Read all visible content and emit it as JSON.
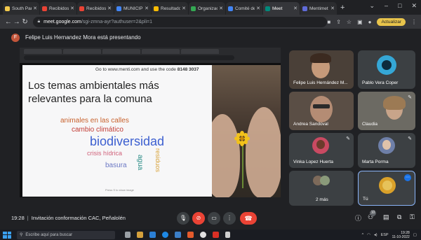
{
  "browser": {
    "tabs": [
      {
        "label": "South Par",
        "color": "#f2c94c",
        "active": false
      },
      {
        "label": "Recibidos",
        "color": "#ea4335",
        "active": false
      },
      {
        "label": "Recibidos",
        "color": "#ea4335",
        "active": false
      },
      {
        "label": "MUNICIP",
        "color": "#4285f4",
        "active": false
      },
      {
        "label": "Resultado",
        "color": "#fbbc04",
        "active": false
      },
      {
        "label": "Organizac",
        "color": "#34a853",
        "active": false
      },
      {
        "label": "Comité de",
        "color": "#4285f4",
        "active": false
      },
      {
        "label": "Meet",
        "color": "#00897b",
        "active": true
      },
      {
        "label": "Mentimet",
        "color": "#5f6bd8",
        "active": false
      }
    ],
    "new_tab": "+",
    "url_domain": "meet.google.com",
    "url_path": "/sgi-zmna-ayr?authuser=2&pli=1",
    "update_button": "Actualizar"
  },
  "banner": {
    "initial": "F",
    "text": "Felipe Luis Hernandez Mora está presentando"
  },
  "slide": {
    "code_prefix": "Go to www.menti.com and use the code",
    "code": "8148 3037",
    "title": "Los temas ambientales más relevantes para la comuna",
    "words": {
      "animales": "animales en las calles",
      "cambio": "cambio climático",
      "bio": "biodiversidad",
      "crisis": "crisis hídrica",
      "basura": "basura",
      "agua": "agua",
      "residuos": "residuos"
    },
    "footer": "Press S to show image"
  },
  "participants": [
    {
      "name": "Felipe Luis Hernández M...",
      "type": "video"
    },
    {
      "name": "Pablo Vera Coper",
      "type": "avatar",
      "color": "#35a7d6"
    },
    {
      "name": "Andrea Sandoval",
      "type": "video"
    },
    {
      "name": "Claudia",
      "type": "video"
    },
    {
      "name": "Vinka Lopez Huerta",
      "type": "avatar",
      "color": "#c94a62"
    },
    {
      "name": "Marta Porma",
      "type": "avatar",
      "color": "#6e7fa8"
    },
    {
      "name": "2 más",
      "type": "more"
    },
    {
      "name": "Tú",
      "type": "self"
    }
  ],
  "meetbar": {
    "time": "19:28",
    "meeting_title": "Invitación conformación CAC, Peñalolén",
    "participant_count": "10"
  },
  "taskbar": {
    "search_placeholder": "Escribe aquí para buscar",
    "lang": "ESP",
    "time": "19:28",
    "date": "11-10-2022"
  }
}
